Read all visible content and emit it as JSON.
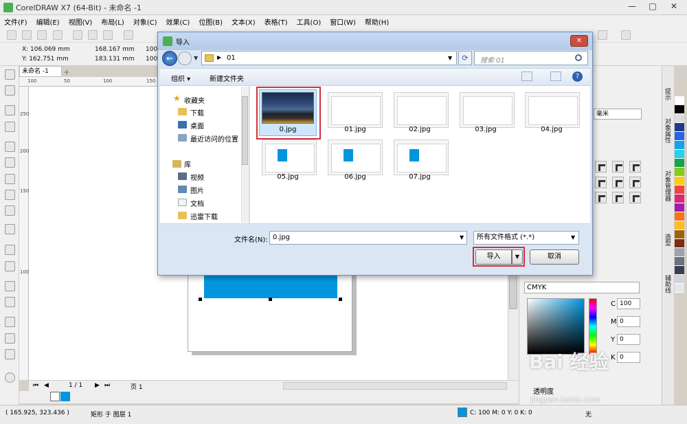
{
  "app": {
    "title": "CorelDRAW X7 (64-Bit) - 未命名 -1",
    "menu": [
      "文件(F)",
      "编辑(E)",
      "视图(V)",
      "布局(L)",
      "对象(C)",
      "效果(C)",
      "位图(B)",
      "文本(X)",
      "表格(T)",
      "工具(O)",
      "窗口(W)",
      "帮助(H)"
    ],
    "window_controls": [
      "—",
      "□",
      "✕"
    ]
  },
  "propbar": {
    "x": "X: 106.069 mm",
    "y": "Y: 162.751 mm",
    "w": "168.167 mm",
    "h": "183.131 mm",
    "scale_a": "100",
    "scale_b": "100"
  },
  "document": {
    "tab": "未命名 -1",
    "ruler_h": [
      "100",
      "50",
      "100",
      "150"
    ],
    "ruler_v": [
      "250",
      "200",
      "150",
      "100"
    ],
    "page_counter": "1 / 1",
    "page_tab": "页 1"
  },
  "dialog": {
    "title": "导入",
    "close": "✕",
    "path": "01",
    "search_placeholder": "搜索 01",
    "organize": "组织 ▾",
    "new_folder": "新建文件夹",
    "help": "?",
    "nav": {
      "favorites": "收藏夹",
      "downloads": "下载",
      "desktop": "桌面",
      "recent": "最近访问的位置",
      "libraries": "库",
      "videos": "视频",
      "pictures": "图片",
      "documents": "文档",
      "thunder": "迅雷下载"
    },
    "files": [
      "0.jpg",
      "01.jpg",
      "02.jpg",
      "03.jpg",
      "04.jpg",
      "05.jpg",
      "06.jpg",
      "07.jpg"
    ],
    "filename_label": "文件名(N):",
    "filename_value": "0.jpg",
    "filetype": "所有文件格式 (*.*)",
    "import_button": "导入",
    "cancel_button": "取消"
  },
  "docker": {
    "unit": "毫米",
    "color_model": "CMYK",
    "c_label": "C",
    "c_value": "100",
    "m_label": "M",
    "m_value": "0",
    "y_label": "Y",
    "y_value": "0",
    "k_label": "K",
    "k_value": "0",
    "transparency": "透明度",
    "tabs": [
      "提示",
      "对象属性",
      "对象管理器",
      "造型",
      "辅助线"
    ]
  },
  "palette": [
    "#ffffff",
    "#000000",
    "#dcdcdc",
    "#1e3a8a",
    "#2563eb",
    "#0ea5e9",
    "#22d3ee",
    "#16a34a",
    "#84cc16",
    "#facc15",
    "#ef4444",
    "#db2777",
    "#a21caf",
    "#f97316",
    "#fbbf24",
    "#a16207",
    "#7c2d12",
    "#9ca3af",
    "#6b7280",
    "#374151",
    "#d1d5db",
    "#e5e7eb"
  ],
  "status": {
    "coords": "( 165.925, 323.436 )",
    "object_info": "矩形 于 图层 1",
    "fill_info": "C: 100 M: 0 Y: 0 K: 0",
    "outline_info": "无"
  },
  "watermark": {
    "main": "Bai 经验",
    "sub": "jingyan.baidu.com"
  }
}
